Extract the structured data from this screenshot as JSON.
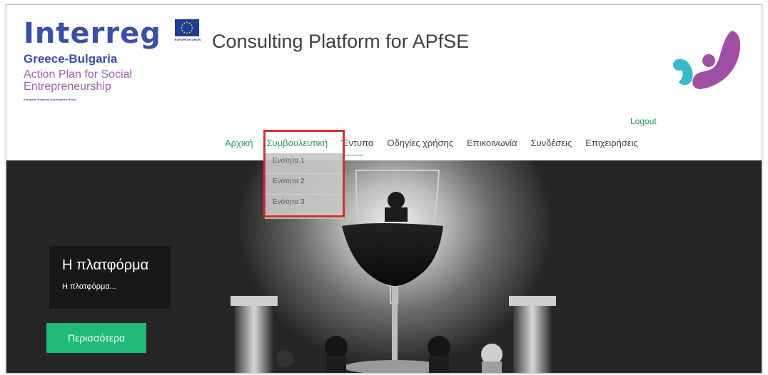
{
  "header": {
    "interreg": "Interreg",
    "program": "Greece-Bulgaria",
    "plan_line1": "Action Plan for Social",
    "plan_line2": "Entrepreneurship",
    "fund": "European Regional Development Fund",
    "eu_caption": "EUROPEAN UNION",
    "site_title": "Consulting Platform for APfSE"
  },
  "colors": {
    "interreg_blue": "#3a4fa8",
    "plan_purple": "#a05fae",
    "accent_green": "#2e9e5a",
    "button_green": "#1fba77",
    "highlight_red": "#d32f2f",
    "logo_teal": "#3bb8c8",
    "logo_purple": "#a04fa6"
  },
  "auth": {
    "logout_label": "Logout"
  },
  "nav": {
    "items": [
      {
        "label": "Αρχική"
      },
      {
        "label": "Συμβουλευτική"
      },
      {
        "label": "Έντυπα"
      },
      {
        "label": "Οδηγίες χρήσης"
      },
      {
        "label": "Επικοινωνία"
      },
      {
        "label": "Συνδέσεις"
      },
      {
        "label": "Επιχειρήσεις"
      }
    ],
    "active_index": 1,
    "dropdown": [
      {
        "label": "Ενότητα 1"
      },
      {
        "label": "Ενότητα 2"
      },
      {
        "label": "Ενότητα 3"
      }
    ]
  },
  "hero": {
    "caption_title": "Η πλατφόρμα",
    "caption_sub": "Η πλατφόρμα...",
    "button_label": "Περισσότερα"
  },
  "icons": {
    "eu": "eu-flag-icon",
    "brand": "brand-logo-icon"
  }
}
